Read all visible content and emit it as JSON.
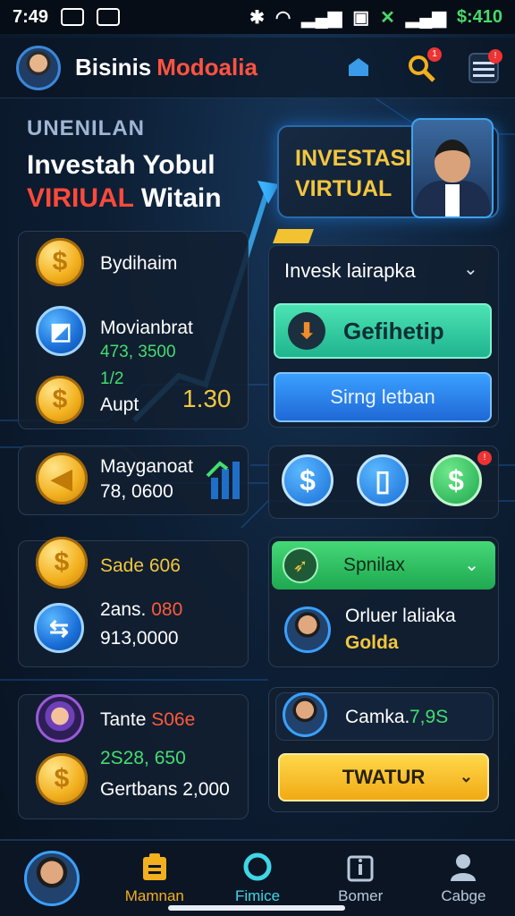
{
  "status_bar": {
    "time": "7:49",
    "right_text": "$:410"
  },
  "header": {
    "brand_part1": "Bisinis",
    "brand_part2": "Modoalia",
    "icon_label": "Qalle"
  },
  "hero": {
    "kicker": "UNENILAN",
    "title": "Investah Yobul",
    "subtitle_red": "VIRIUAL",
    "subtitle_rest": "Witain",
    "card_line1": "INVESTASI",
    "card_line2": "VIRTUAL"
  },
  "left_panel": {
    "item1_label": "Bydihaim",
    "item2_label": "Movianbrat",
    "item2_value": "473, 3500",
    "item3_top": "1/2",
    "item3_label": "Aupt",
    "item3_value": "1.30"
  },
  "right_panel": {
    "dropdown_title": "Invesk lairapka",
    "green_button": "Gefihetip",
    "blue_button": "Sirng letban"
  },
  "mid_left": {
    "label": "Mayganoat",
    "value": "78, 0600"
  },
  "sade_panel": {
    "label": "Sade 606",
    "label2": "2ans.",
    "label2_red": "080",
    "value": "913,0000"
  },
  "spin_panel": {
    "title": "Spnilax",
    "line1": "Orluer laliaka",
    "line2": "Golda"
  },
  "tante_panel": {
    "label": "Tante",
    "label_red": "S06e",
    "green_value": "2S28, 650",
    "value": "Gertbans 2,000"
  },
  "camka_panel": {
    "label": "Camka.",
    "value": "7,9S",
    "button": "TWATUR"
  },
  "nav": {
    "items": [
      "Mamnan",
      "Fimice",
      "Bomer",
      "Cabge"
    ]
  },
  "colors": {
    "accent_yellow": "#f2c63e",
    "accent_green": "#45dd70",
    "accent_red": "#ff5a3a",
    "accent_blue": "#3aa0ff"
  }
}
